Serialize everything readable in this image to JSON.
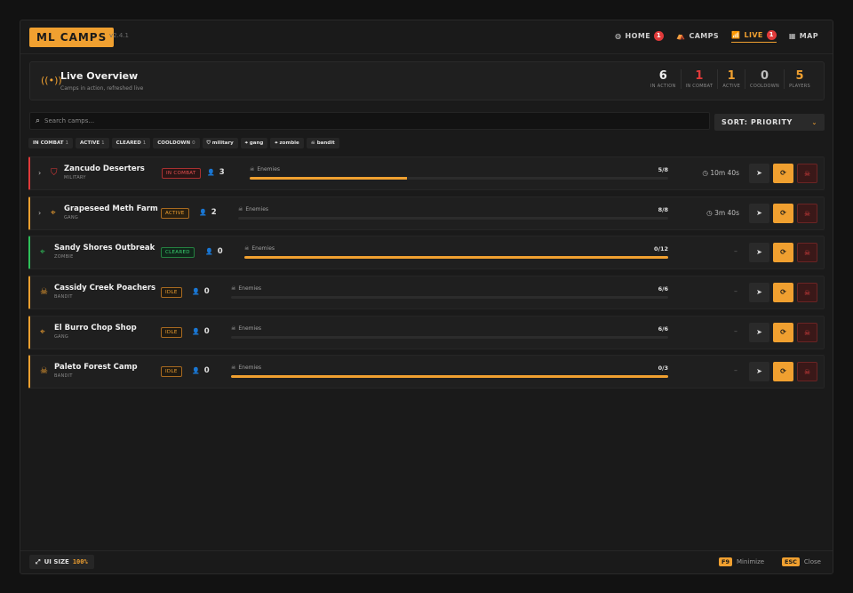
{
  "app": {
    "logo": "ML CAMPS",
    "version": "v2.4.1"
  },
  "nav": [
    {
      "label": "HOME",
      "icon": "home-icon",
      "glyph": "◍",
      "badge": "1"
    },
    {
      "label": "CAMPS",
      "icon": "camps-icon",
      "glyph": "⛺",
      "badge": ""
    },
    {
      "label": "LIVE",
      "icon": "antenna-icon",
      "glyph": "📶",
      "badge": "1",
      "active": true
    },
    {
      "label": "MAP",
      "icon": "map-icon",
      "glyph": "▦",
      "badge": ""
    }
  ],
  "overview": {
    "title": "Live Overview",
    "subtitle": "Camps in action, refreshed live",
    "stats": [
      {
        "value": "6",
        "label": "IN ACTION",
        "color": "#f0f0f0"
      },
      {
        "value": "1",
        "label": "IN COMBAT",
        "color": "#e03a3a"
      },
      {
        "value": "1",
        "label": "ACTIVE",
        "color": "#f0a030"
      },
      {
        "value": "0",
        "label": "COOLDOWN",
        "color": "#bdbdbd"
      },
      {
        "value": "5",
        "label": "PLAYERS",
        "color": "#f0a030"
      }
    ]
  },
  "search": {
    "placeholder": "Search camps..."
  },
  "sort": {
    "label": "SORT: PRIORITY"
  },
  "filters": [
    {
      "label": "IN COMBAT",
      "count": "1"
    },
    {
      "label": "ACTIVE",
      "count": "1"
    },
    {
      "label": "CLEARED",
      "count": "1"
    },
    {
      "label": "COOLDOWN",
      "count": "0"
    },
    {
      "label": "military",
      "icon": "shield-icon",
      "glyph": "⛉"
    },
    {
      "label": "gang",
      "icon": "crosshair-icon",
      "glyph": "⌖"
    },
    {
      "label": "zombie",
      "icon": "biohazard-icon",
      "glyph": "⌖"
    },
    {
      "label": "bandit",
      "icon": "skull-icon",
      "glyph": "☠"
    }
  ],
  "enemies_label": "Enemies",
  "camps": [
    {
      "name": "Zancudo Deserters",
      "type": "MILITARY",
      "status": "IN COMBAT",
      "status_class": "combat",
      "players": "3",
      "enemies": "5/8",
      "progress": 0.375,
      "timer": "10m 40s",
      "expandable": true,
      "icon": "shield-icon",
      "glyph": "⛉",
      "icon_color": "#e03a3a"
    },
    {
      "name": "Grapeseed Meth Farm",
      "type": "GANG",
      "status": "ACTIVE",
      "status_class": "active",
      "players": "2",
      "enemies": "8/8",
      "progress": 0,
      "timer": "3m 40s",
      "expandable": true,
      "icon": "crosshair-icon",
      "glyph": "⌖",
      "icon_color": "#f0a030"
    },
    {
      "name": "Sandy Shores Outbreak",
      "type": "ZOMBIE",
      "status": "CLEARED",
      "status_class": "cleared",
      "players": "0",
      "enemies": "0/12",
      "progress": 1,
      "timer": "–",
      "expandable": false,
      "icon": "biohazard-icon",
      "glyph": "⌖",
      "icon_color": "#2fbf5a"
    },
    {
      "name": "Cassidy Creek Poachers",
      "type": "BANDIT",
      "status": "IDLE",
      "status_class": "idle",
      "players": "0",
      "enemies": "6/6",
      "progress": 0,
      "timer": "–",
      "expandable": false,
      "icon": "skull-icon",
      "glyph": "☠",
      "icon_color": "#f0a030"
    },
    {
      "name": "El Burro Chop Shop",
      "type": "GANG",
      "status": "IDLE",
      "status_class": "idle",
      "players": "0",
      "enemies": "6/6",
      "progress": 0,
      "timer": "–",
      "expandable": false,
      "icon": "crosshair-icon",
      "glyph": "⌖",
      "icon_color": "#f0a030"
    },
    {
      "name": "Paleto Forest Camp",
      "type": "BANDIT",
      "status": "IDLE",
      "status_class": "idle",
      "players": "0",
      "enemies": "0/3",
      "progress": 1,
      "timer": "–",
      "expandable": false,
      "icon": "skull-icon",
      "glyph": "☠",
      "icon_color": "#f0a030"
    }
  ],
  "footer": {
    "ui_size_label": "UI SIZE",
    "ui_size_value": "100%",
    "minimize_key": "F9",
    "minimize_label": "Minimize",
    "close_key": "ESC",
    "close_label": "Close"
  }
}
